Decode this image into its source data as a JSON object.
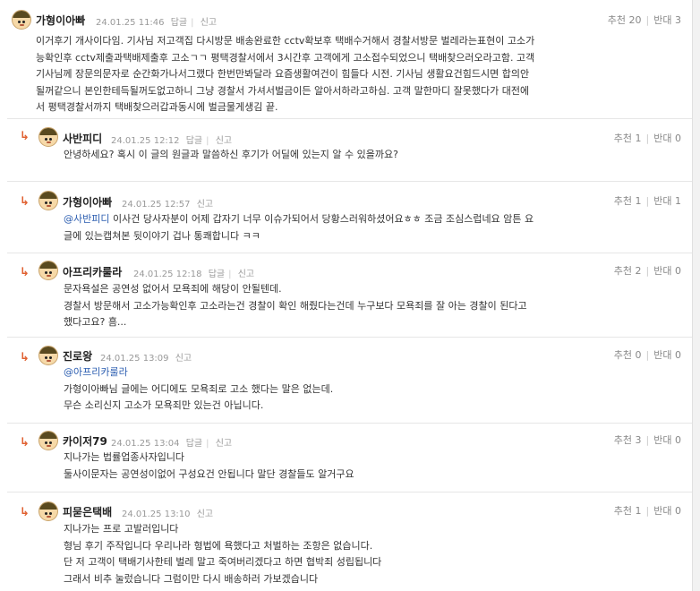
{
  "labels": {
    "reply": "답글",
    "report": "신고",
    "up": "추천",
    "down": "반대"
  },
  "comments": [
    {
      "author": "가형이아빠",
      "date": "24.01.25 11:46",
      "up": "20",
      "down": "3",
      "lines": [
        "이거후기 개사이다임. 기사님 저고객집 다시방문 배송완료한 cctv확보후 택배수거해서 경찰서방문 벌레라는표현이 고소가",
        "능확인후 cctv제출과택배제출후 고소ㄱㄱ 평택경찰서에서 3시간후 고객에게 고소접수되었으니 택배찾으러오라고함. 고객",
        "기사님께 장문의문자로 순간화가나서그랬다 한번만봐달라 요즘생활여건이 힘들다 시전. 기사님 생활요건힘드시면 합의안",
        "될꺼같으니 본인한테득될꺼도없고하니 그냥 경찰서 가셔서벌금이든 알아서하라고하심. 고객 말한마디 잘못했다가 대전에",
        "서 평택경찰서까지 택배찾으러갑과동시에 벌금물게생김 끝."
      ]
    },
    {
      "author": "사반피디",
      "date": "24.01.25 12:12",
      "up": "1",
      "down": "0",
      "lines": [
        "안녕하세요? 혹시 이 글의 원글과 말씀하신 후기가 어딜에 있는지 알 수 있을까요?"
      ]
    },
    {
      "author": "가형이아빠",
      "date": "24.01.25 12:57",
      "up": "1",
      "down": "1",
      "mention": "@사반피디",
      "lines": [
        " 이사건 당사자분이 어제 갑자기 너무 이슈가되어서 당황스러워하셨어요ㅎㅎ 조금 조심스럽네요 암튼 요",
        "글에 있는캡쳐본 뒷이야기 겁나 통쾌합니다 ㅋㅋ"
      ]
    },
    {
      "author": "아프리카룰라",
      "date": "24.01.25 12:18",
      "up": "2",
      "down": "0",
      "lines": [
        "문자욕설은 공연성 없어서 모욕죄에 해당이 안될텐데.",
        "경찰서 방문해서 고소가능확인후 고소라는건 경찰이 확인 해줬다는건데 누구보다 모욕죄를 잘 아는 경찰이 된다고",
        "했다고요? 흠..."
      ]
    },
    {
      "author": "진로왕",
      "date": "24.01.25 13:09",
      "up": "0",
      "down": "0",
      "mention": "@아프리카룰라",
      "lines": [
        "",
        "가형이아빠님 글에는 어디에도 모욕죄로 고소 했다는 말은 없는데.",
        "무슨 소리신지 고소가 모욕죄만 있는건 아닙니다."
      ]
    },
    {
      "author": "카이저79",
      "date": "24.01.25 13:04",
      "up": "3",
      "down": "0",
      "lines": [
        "지나가는 법률업종사자입니다",
        "둘사이문자는 공연성이없어 구성요건 안됩니다 말단 경찰들도 알거구요"
      ]
    },
    {
      "author": "피묻은택배",
      "date": "24.01.25 13:10",
      "up": "1",
      "down": "0",
      "lines": [
        "지나가는 프로 고발러입니다",
        "형님 후기 주작입니다 우리나라 형법에 욕했다고 처벌하는 조항은 없습니다.",
        "단 저 고객이 택배기사한테 벌레 말고 죽여버리겠다고 하면 협박죄 성립됩니다",
        "그래서 비추 눌렀습니다 그럼이만 다시 배송하러 가보겠습니다"
      ]
    }
  ]
}
